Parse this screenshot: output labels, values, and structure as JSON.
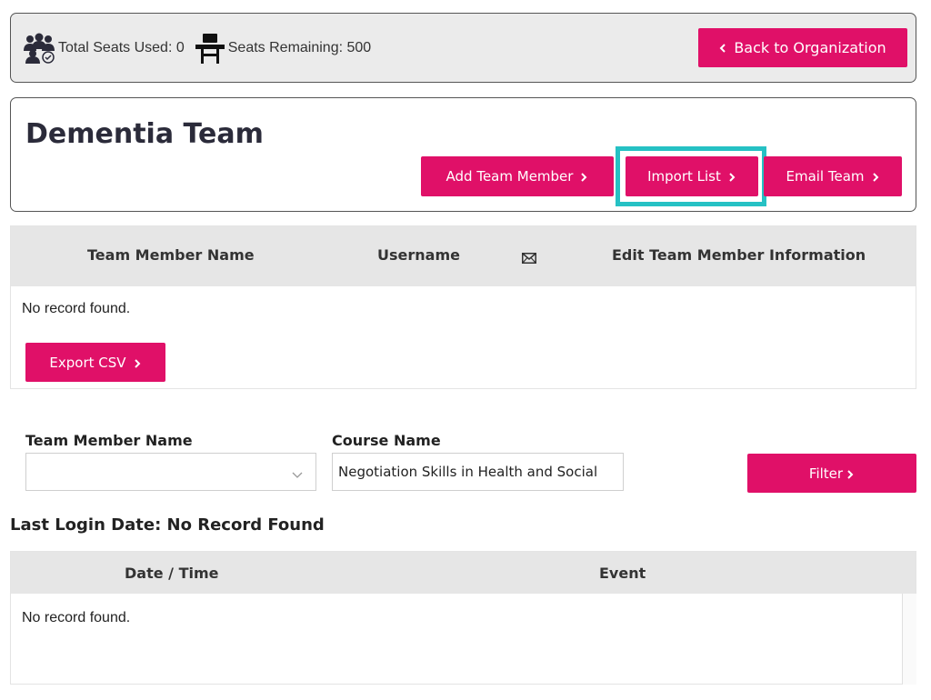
{
  "seats": {
    "used_label": "Total Seats Used: 0",
    "remaining_label": "Seats Remaining: 500",
    "used_icon": "team-check-icon",
    "remaining_icon": "chair-icon"
  },
  "header": {
    "back_label": "Back to Organization"
  },
  "team": {
    "title": "Dementia Team",
    "add_label": "Add Team Member",
    "import_label": "Import List",
    "email_label": "Email Team"
  },
  "members_table": {
    "columns": [
      "Team Member Name",
      "Username",
      "Edit Team Member Information"
    ],
    "mail_icon": "envelope-icon",
    "empty_text": "No record found.",
    "export_label": "Export CSV"
  },
  "filters": {
    "member_label": "Team Member Name",
    "member_value": "",
    "course_label": "Course Name",
    "course_value": "Negotiation Skills in Health and Social",
    "filter_label": "Filter"
  },
  "login": {
    "heading": "Last Login Date: No Record Found",
    "columns": [
      "Date / Time",
      "Event"
    ],
    "empty_text": "No record found."
  },
  "colors": {
    "accent": "#e01068",
    "highlight": "#26c1c4",
    "header_bg": "#e6e6e6"
  }
}
